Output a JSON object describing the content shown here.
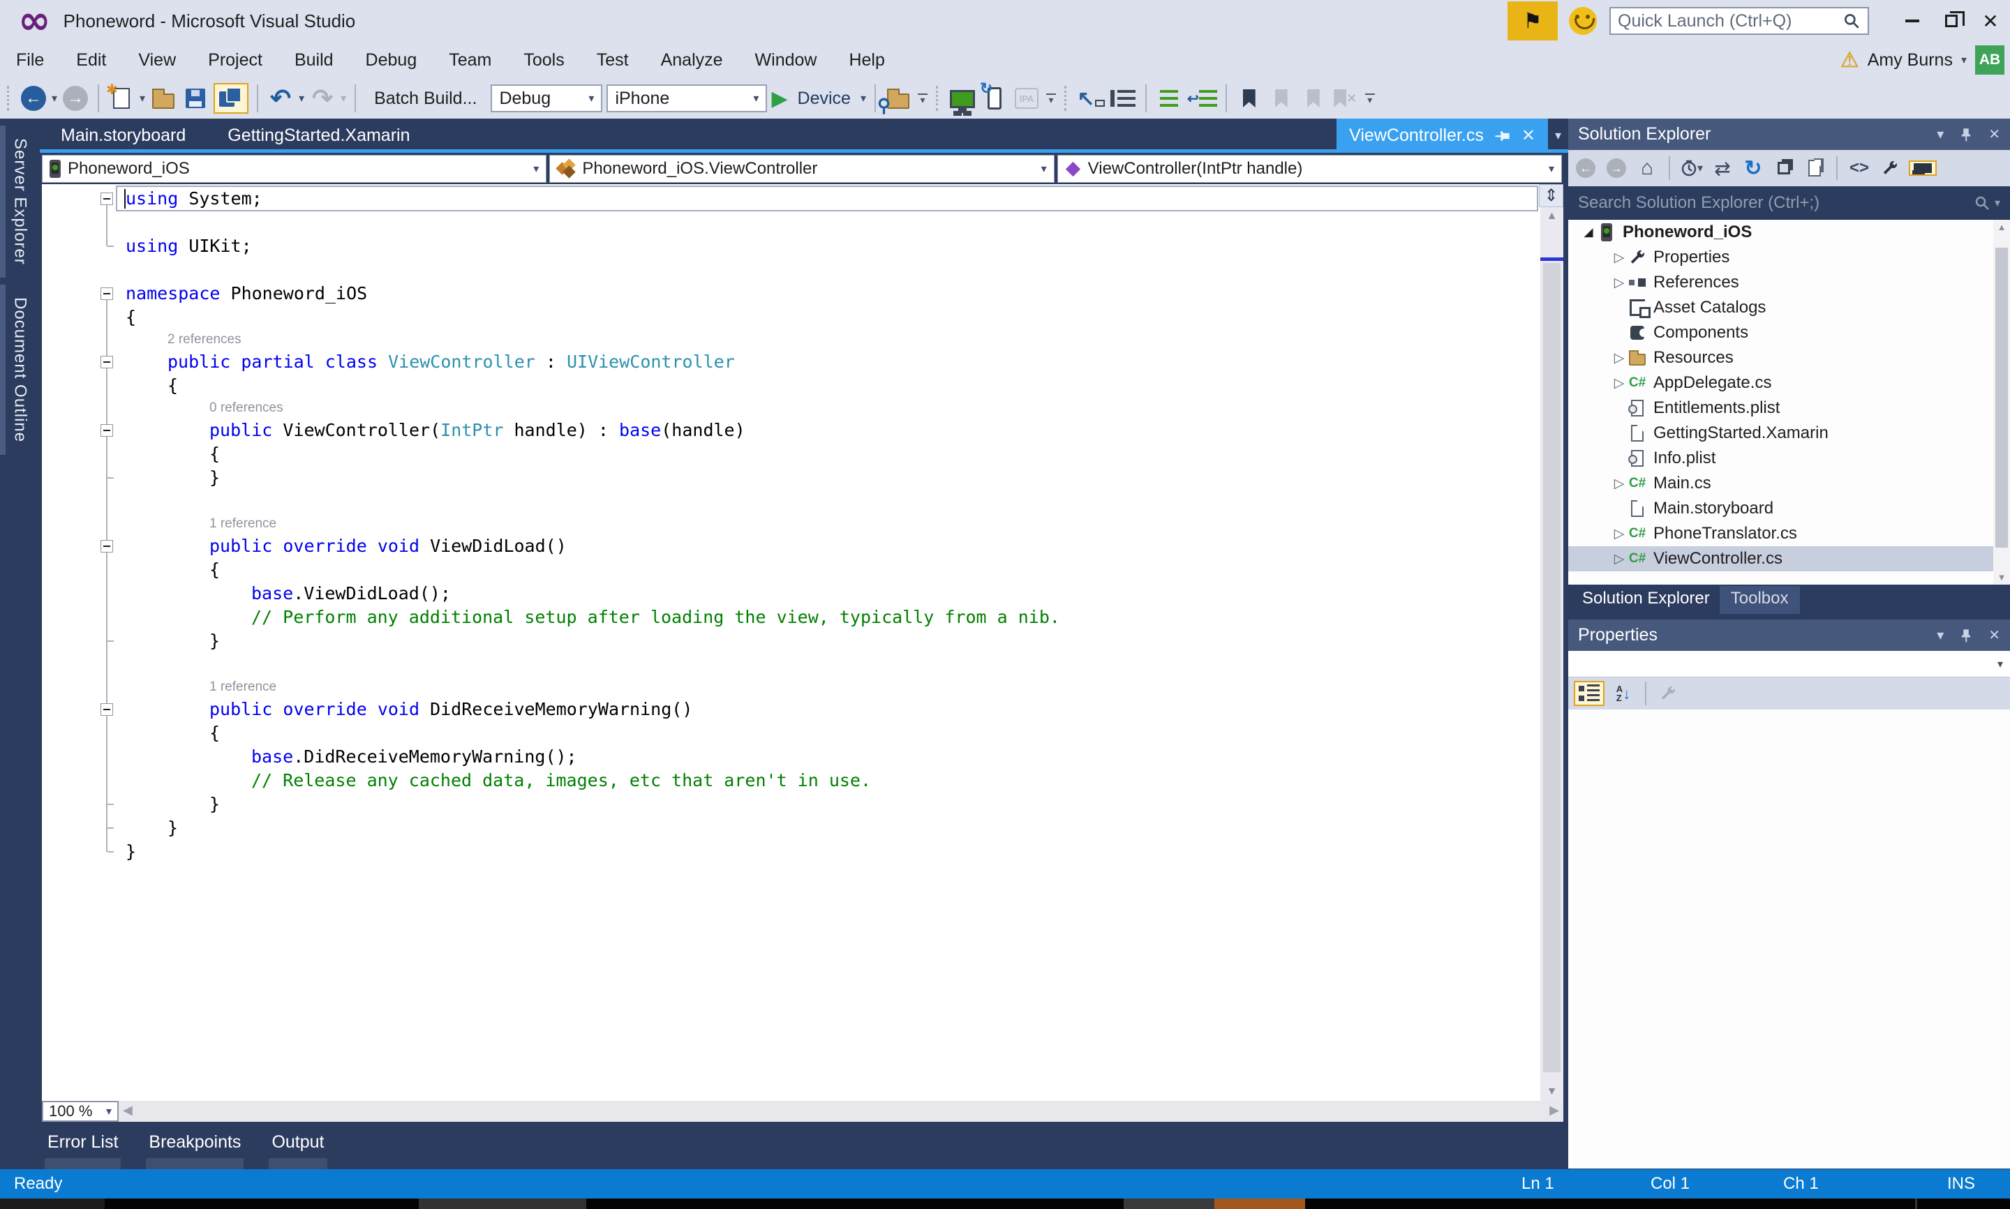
{
  "window": {
    "title": "Phoneword - Microsoft Visual Studio",
    "quick_launch_placeholder": "Quick Launch (Ctrl+Q)",
    "user_name": "Amy Burns",
    "user_initials": "AB"
  },
  "menu": {
    "items": [
      "File",
      "Edit",
      "View",
      "Project",
      "Build",
      "Debug",
      "Team",
      "Tools",
      "Test",
      "Analyze",
      "Window",
      "Help"
    ]
  },
  "toolbar": {
    "batch_build_label": "Batch Build...",
    "config_value": "Debug",
    "platform_value": "iPhone",
    "device_label": "Device"
  },
  "left_tabs": [
    "Server Explorer",
    "Document Outline"
  ],
  "doc_tabs": {
    "inactive": [
      "Main.storyboard",
      "GettingStarted.Xamarin"
    ],
    "active": "ViewController.cs"
  },
  "breadcrumb": {
    "project": "Phoneword_iOS",
    "type": "Phoneword_iOS.ViewController",
    "member": "ViewController(IntPtr handle)"
  },
  "editor": {
    "zoom_level": "100 %",
    "fold_segments": [
      {
        "from": 1,
        "to": 3
      },
      {
        "from": 5,
        "to": 29
      }
    ],
    "fold_end_ticks": [
      3,
      13,
      20,
      27,
      28,
      29
    ],
    "lines": [
      {
        "t": "code",
        "i": 0,
        "fold": true,
        "cur": true,
        "tok": [
          [
            "k",
            "using"
          ],
          [
            "p",
            " System;"
          ]
        ]
      },
      {
        "t": "blank"
      },
      {
        "t": "code",
        "i": 0,
        "tok": [
          [
            "k",
            "using"
          ],
          [
            "p",
            " UIKit;"
          ]
        ]
      },
      {
        "t": "blank"
      },
      {
        "t": "code",
        "i": 0,
        "fold": true,
        "tok": [
          [
            "k",
            "namespace"
          ],
          [
            "p",
            " Phoneword_iOS"
          ]
        ]
      },
      {
        "t": "code",
        "i": 0,
        "tok": [
          [
            "p",
            "{"
          ]
        ]
      },
      {
        "t": "lens",
        "i": 1,
        "text": "2 references"
      },
      {
        "t": "code",
        "i": 1,
        "fold": true,
        "tok": [
          [
            "k",
            "public partial class"
          ],
          [
            "p",
            " "
          ],
          [
            "t",
            "ViewController"
          ],
          [
            "p",
            " : "
          ],
          [
            "t",
            "UIViewController"
          ]
        ]
      },
      {
        "t": "code",
        "i": 1,
        "tok": [
          [
            "p",
            "{"
          ]
        ]
      },
      {
        "t": "lens",
        "i": 2,
        "text": "0 references"
      },
      {
        "t": "code",
        "i": 2,
        "fold": true,
        "tok": [
          [
            "k",
            "public"
          ],
          [
            "p",
            " ViewController("
          ],
          [
            "t",
            "IntPtr"
          ],
          [
            "p",
            " handle) : "
          ],
          [
            "k",
            "base"
          ],
          [
            "p",
            "(handle)"
          ]
        ]
      },
      {
        "t": "code",
        "i": 2,
        "tok": [
          [
            "p",
            "{"
          ]
        ]
      },
      {
        "t": "code",
        "i": 2,
        "tok": [
          [
            "p",
            "}"
          ]
        ]
      },
      {
        "t": "blank"
      },
      {
        "t": "lens",
        "i": 2,
        "text": "1 reference"
      },
      {
        "t": "code",
        "i": 2,
        "fold": true,
        "tok": [
          [
            "k",
            "public override void"
          ],
          [
            "p",
            " ViewDidLoad()"
          ]
        ]
      },
      {
        "t": "code",
        "i": 2,
        "tok": [
          [
            "p",
            "{"
          ]
        ]
      },
      {
        "t": "code",
        "i": 3,
        "tok": [
          [
            "k",
            "base"
          ],
          [
            "p",
            ".ViewDidLoad();"
          ]
        ]
      },
      {
        "t": "code",
        "i": 3,
        "tok": [
          [
            "c",
            "// Perform any additional setup after loading the view, typically from a nib."
          ]
        ]
      },
      {
        "t": "code",
        "i": 2,
        "tok": [
          [
            "p",
            "}"
          ]
        ]
      },
      {
        "t": "blank"
      },
      {
        "t": "lens",
        "i": 2,
        "text": "1 reference"
      },
      {
        "t": "code",
        "i": 2,
        "fold": true,
        "tok": [
          [
            "k",
            "public override void"
          ],
          [
            "p",
            " DidReceiveMemoryWarning()"
          ]
        ]
      },
      {
        "t": "code",
        "i": 2,
        "tok": [
          [
            "p",
            "{"
          ]
        ]
      },
      {
        "t": "code",
        "i": 3,
        "tok": [
          [
            "k",
            "base"
          ],
          [
            "p",
            ".DidReceiveMemoryWarning();"
          ]
        ]
      },
      {
        "t": "code",
        "i": 3,
        "tok": [
          [
            "c",
            "// Release any cached data, images, etc that aren't in use."
          ]
        ]
      },
      {
        "t": "code",
        "i": 2,
        "tok": [
          [
            "p",
            "}"
          ]
        ]
      },
      {
        "t": "code",
        "i": 1,
        "tok": [
          [
            "p",
            "}"
          ]
        ]
      },
      {
        "t": "code",
        "i": 0,
        "tok": [
          [
            "p",
            "}"
          ]
        ]
      }
    ]
  },
  "solution_explorer": {
    "title": "Solution Explorer",
    "search_placeholder": "Search Solution Explorer (Ctrl+;)",
    "tree": [
      {
        "label": "Phoneword_iOS",
        "icon": "iphone-project",
        "level": 0,
        "expander": "expanded",
        "bold": true
      },
      {
        "label": "Properties",
        "icon": "wrench",
        "level": 1,
        "expander": "collapsed"
      },
      {
        "label": "References",
        "icon": "references",
        "level": 1,
        "expander": "collapsed"
      },
      {
        "label": "Asset Catalogs",
        "icon": "asset-catalogs",
        "level": 1
      },
      {
        "label": "Components",
        "icon": "components",
        "level": 1
      },
      {
        "label": "Resources",
        "icon": "folder",
        "level": 1,
        "expander": "collapsed"
      },
      {
        "label": "AppDelegate.cs",
        "icon": "csharp",
        "level": 1,
        "expander": "collapsed"
      },
      {
        "label": "Entitlements.plist",
        "icon": "plist",
        "level": 1
      },
      {
        "label": "GettingStarted.Xamarin",
        "icon": "file",
        "level": 1
      },
      {
        "label": "Info.plist",
        "icon": "plist",
        "level": 1
      },
      {
        "label": "Main.cs",
        "icon": "csharp",
        "level": 1,
        "expander": "collapsed"
      },
      {
        "label": "Main.storyboard",
        "icon": "file",
        "level": 1
      },
      {
        "label": "PhoneTranslator.cs",
        "icon": "csharp",
        "level": 1,
        "expander": "collapsed"
      },
      {
        "label": "ViewController.cs",
        "icon": "csharp",
        "level": 1,
        "expander": "collapsed",
        "selected": true
      }
    ],
    "tab_active": "Solution Explorer",
    "tab_inactive": "Toolbox"
  },
  "properties": {
    "title": "Properties"
  },
  "bottom_panel": {
    "tabs": [
      "Error List",
      "Breakpoints",
      "Output"
    ]
  },
  "status_bar": {
    "message": "Ready",
    "line": "Ln 1",
    "column": "Col 1",
    "character": "Ch 1",
    "mode": "INS"
  },
  "colors": {
    "accent_blue": "#3aa0f0",
    "status_bar_blue": "#0a7bd0",
    "title_flag_yellow": "#e9b516",
    "avatar_green": "#3fa457",
    "keyword_blue": "#0000f0",
    "type_teal": "#2b91af",
    "comment_green": "#008000",
    "codelens_gray": "#8e939b",
    "selected_row": "#c7cedd",
    "taskbar_orange": "#a3571c"
  }
}
